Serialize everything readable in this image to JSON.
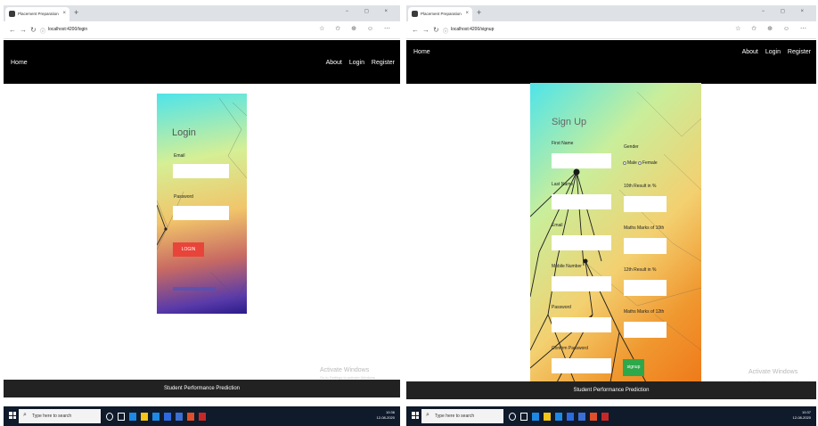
{
  "browser": {
    "tab_title": "Placement Preparation",
    "tab_close": "×",
    "new_tab": "+",
    "window_controls": "− ◻ ×",
    "left_url": "localhost:4200/login",
    "right_url": "localhost:4200/signup",
    "tools": "☆ ✩ ⊕ ☺ ⋯"
  },
  "navbar": {
    "home": "Home",
    "about": "About",
    "login": "Login",
    "register": "Register"
  },
  "login": {
    "title": "Login",
    "email_label": "Email",
    "password_label": "Password",
    "button": "LOGIN"
  },
  "signup": {
    "title": "Sign Up",
    "first_name": "First Name",
    "last_name": "Last Name",
    "email": "Email",
    "mobile": "Mobile Number",
    "password": "Password",
    "confirm_password": "Confirm Password",
    "gender": "Gender",
    "male": "Male",
    "female": "Female",
    "tenth_result": "10th Result in %",
    "maths_tenth": "Maths Marks of 10th",
    "twelfth_result": "12th Result in %",
    "maths_twelfth": "Maths Marks of 12th",
    "button": "signup"
  },
  "footer": {
    "text": "Student Performance Prediction"
  },
  "watermark": {
    "title": "Activate Windows",
    "sub": "Go to Settings to activate Windows."
  },
  "taskbar": {
    "search_placeholder": "Type here to search",
    "left_time": "10:36",
    "left_date": "12-08-2020",
    "right_time": "10:37",
    "right_date": "12-08-2020"
  },
  "colors": {
    "login_button": "#e8443a",
    "signup_button": "#2da84a",
    "navbar": "#000000",
    "footer": "#222222",
    "taskbar": "#0f1a2b"
  }
}
